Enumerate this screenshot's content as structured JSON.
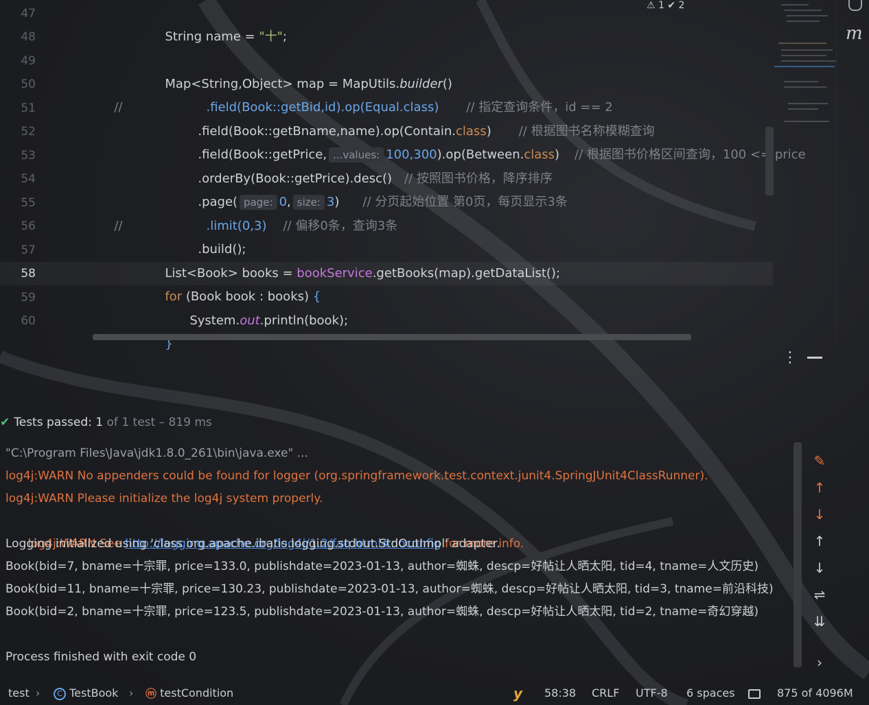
{
  "editor": {
    "lines": [
      {
        "num": "47",
        "current": false
      },
      {
        "num": "48",
        "current": false
      },
      {
        "num": "49",
        "current": false
      },
      {
        "num": "50",
        "current": false
      },
      {
        "num": "51",
        "current": false
      },
      {
        "num": "52",
        "current": false
      },
      {
        "num": "53",
        "current": false
      },
      {
        "num": "54",
        "current": false
      },
      {
        "num": "55",
        "current": false
      },
      {
        "num": "56",
        "current": false
      },
      {
        "num": "57",
        "current": false
      },
      {
        "num": "58",
        "current": true
      },
      {
        "num": "59",
        "current": false
      },
      {
        "num": "60",
        "current": false
      }
    ],
    "code": {
      "l47_a": "String name = ",
      "l47_str": "\"十\"",
      "l47_b": ";",
      "l49_a": "Map<String,Object> map = MapUtils.",
      "l49_b": "builder",
      "l49_c": "()",
      "l50_mark": "//",
      "l50_code": ".field(Book::getBid,id).op(Equal.class)",
      "l50_comment": "// 指定查询条件，id == 2",
      "l51_a": ".field(Book::getBname,name).op(Contain.",
      "l51_kw": "class",
      "l51_b": ")",
      "l51_comment": "// 根据图书名称模糊查询",
      "l52_a": ".field(Book::getPrice,",
      "l52_hint": "...values:",
      "l52_num": "100,300",
      "l52_b": ").op(Between.",
      "l52_kw": "class",
      "l52_c": ")",
      "l52_comment": "// 根据图书价格区间查询，100 <= price",
      "l53_a": ".orderBy(Book::getPrice).desc()",
      "l53_comment": "// 按照图书价格，降序排序",
      "l54_a": ".page(",
      "l54_hint1": "page:",
      "l54_n1": "0",
      "l54_comma": ",",
      "l54_hint2": "size:",
      "l54_n2": "3",
      "l54_b": ")",
      "l54_comment": "// 分页起始位置 第0页，每页显示3条",
      "l55_mark": "//",
      "l55_code": ".limit(0,3)",
      "l55_comment": "// 偏移0条，查询3条",
      "l56_a": ".build();",
      "l57_a": "List<Book> books = ",
      "l57_field": "bookService",
      "l57_b": ".getBooks(map).getDataList();",
      "l58_kw": "for",
      "l58_a": " (Book book : books) ",
      "l58_brace": "{",
      "l59_a": "System.",
      "l59_out": "out",
      "l59_b": ".println(book);",
      "l60_brace": "}"
    },
    "top_status": "⚠ 1  ✔ 2",
    "side_letter": "m"
  },
  "run": {
    "tests_passed_label": "Tests passed:",
    "tests_passed_count": "1",
    "tests_passed_sub": "of 1 test – 819 ms",
    "console": [
      {
        "type": "cmd",
        "text": "\"C:\\Program Files\\Java\\jdk1.8.0_261\\bin\\java.exe\" ..."
      },
      {
        "type": "warn",
        "text": "log4j:WARN No appenders could be found for logger (org.springframework.test.context.junit4.SpringJUnit4ClassRunner)."
      },
      {
        "type": "warn",
        "text": "log4j:WARN Please initialize the log4j system properly."
      },
      {
        "type": "warn_link",
        "pre": "log4j:WARN See ",
        "link": "http://logging.apache.org/log4j/1.2/faq.html#noconfig",
        "post": " for more info."
      },
      {
        "type": "norm",
        "text": "Logging initialized using 'class org.apache.ibatis.logging.stdout.StdOutImpl' adapter."
      },
      {
        "type": "norm",
        "text": "Book(bid=7, bname=十宗罪, price=133.0, publishdate=2023-01-13, author=蜘蛛, descp=好帖让人晒太阳, tid=4, tname=人文历史)"
      },
      {
        "type": "norm",
        "text": "Book(bid=11, bname=十宗罪, price=130.23, publishdate=2023-01-13, author=蜘蛛, descp=好帖让人晒太阳, tid=3, tname=前沿科技)"
      },
      {
        "type": "norm",
        "text": "Book(bid=2, bname=十宗罪, price=123.5, publishdate=2023-01-13, author=蜘蛛, descp=好帖让人晒太阳, tid=2, tname=奇幻穿越)"
      },
      {
        "type": "norm",
        "text": ""
      },
      {
        "type": "norm",
        "text": "Process finished with exit code 0"
      }
    ],
    "tool_icons": [
      "clear-icon",
      "prev-failed-icon",
      "next-failed-icon",
      "up-arrow-icon",
      "down-arrow-icon",
      "soft-wrap-icon",
      "scroll-to-end-icon",
      "expand-icon"
    ]
  },
  "statusbar": {
    "crumb1": "test",
    "crumb2": "TestBook",
    "crumb3": "testCondition",
    "position": "58:38",
    "line_sep": "CRLF",
    "encoding": "UTF-8",
    "indent": "6 spaces",
    "memory": "875 of 4096M"
  },
  "colors": {
    "warning": "#e0733f",
    "link": "#4c8ee6",
    "success": "#4cc17a",
    "keyword": "#c98c52"
  }
}
